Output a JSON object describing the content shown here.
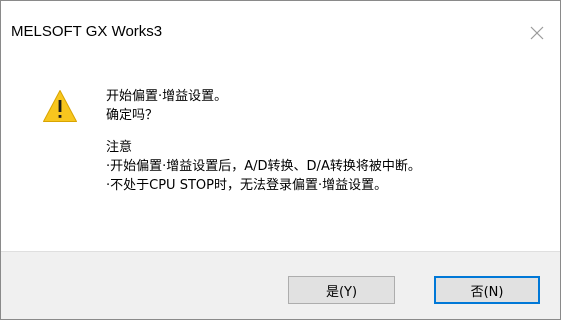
{
  "window": {
    "title": "MELSOFT GX Works3"
  },
  "message": {
    "line1": "开始偏置·增益设置。",
    "line2": "确定吗？",
    "note_heading": "注意",
    "note_line1": "·开始偏置·增益设置后，A/D转换、D/A转换将被中断。",
    "note_line2": "·不处于CPU STOP时，无法登录偏置·增益设置。"
  },
  "buttons": {
    "yes_label": "是(Y)",
    "no_label": "否(N)"
  },
  "icons": {
    "warning": "warning-triangle-icon",
    "close": "close-icon"
  },
  "colors": {
    "warning_fill": "#f7c61e",
    "focus_border": "#0078d7",
    "footer_bg": "#f0f0f0"
  }
}
